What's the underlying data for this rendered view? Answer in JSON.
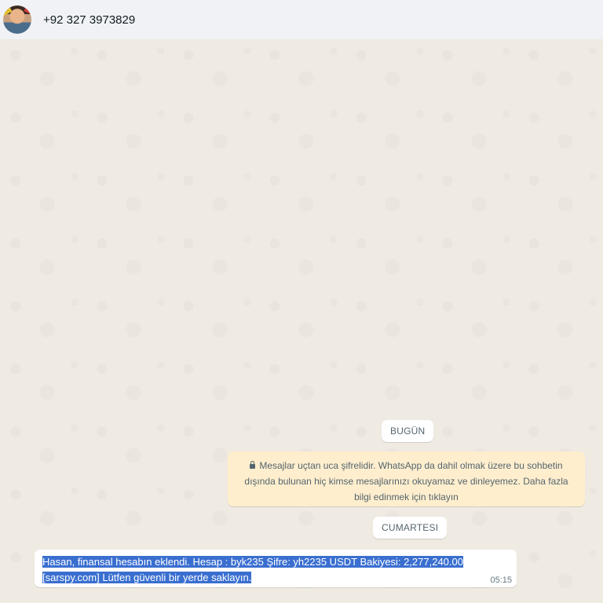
{
  "header": {
    "contact_name": "+92 327 3973829"
  },
  "chat": {
    "date_today": "BUGÜN",
    "encryption_notice": "Mesajlar uçtan uca şifrelidir. WhatsApp da dahil olmak üzere bu sohbetin dışında bulunan hiç kimse mesajlarınızı okuyamaz ve dinleyemez. Daha fazla bilgi edinmek için tıklayın",
    "date_saturday": "CUMARTESI",
    "messages": [
      {
        "text": "Hasan, finansal hesabın eklendi. Hesap : byk235  Şifre: yh2235 USDT Bakiyesi: 2,277,240.00 [sarspy.com] Lütfen güvenli bir yerde saklayın.",
        "time": "05:15"
      }
    ]
  },
  "colors": {
    "notice_bg": "#ffeecd",
    "selection": "#3a6fd0",
    "chat_bg": "#efeae2"
  }
}
